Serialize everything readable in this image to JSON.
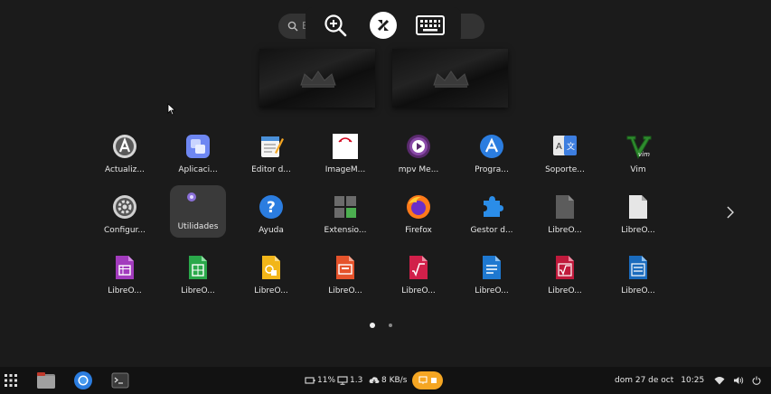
{
  "search": {
    "placeholder": "E"
  },
  "apps_row1": [
    {
      "label": "Actualiz...",
      "icon": "software-updater-icon"
    },
    {
      "label": "Aplicaci...",
      "icon": "applications-icon"
    },
    {
      "label": "Editor d...",
      "icon": "text-editor-icon"
    },
    {
      "label": "ImageM...",
      "icon": "imagemagick-icon"
    },
    {
      "label": "mpv Me...",
      "icon": "mpv-media-player-icon"
    },
    {
      "label": "Progra...",
      "icon": "software-icon"
    },
    {
      "label": "Soporte...",
      "icon": "language-support-icon"
    },
    {
      "label": "Vim",
      "icon": "vim-icon"
    }
  ],
  "apps_row2": [
    {
      "label": "Configur...",
      "icon": "settings-icon"
    },
    {
      "label": "Utilidades",
      "icon": "utilities-folder-icon"
    },
    {
      "label": "Ayuda",
      "icon": "help-icon"
    },
    {
      "label": "Extensio...",
      "icon": "extensions-icon"
    },
    {
      "label": "Firefox",
      "icon": "firefox-icon"
    },
    {
      "label": "Gestor d...",
      "icon": "extension-manager-icon"
    },
    {
      "label": "LibreO...",
      "icon": "libreoffice-icon"
    },
    {
      "label": "LibreO...",
      "icon": "libreoffice-document-icon"
    }
  ],
  "apps_row3": [
    {
      "label": "LibreO...",
      "icon": "libreoffice-base-icon"
    },
    {
      "label": "LibreO...",
      "icon": "libreoffice-calc-icon"
    },
    {
      "label": "LibreO...",
      "icon": "libreoffice-draw-icon"
    },
    {
      "label": "LibreO...",
      "icon": "libreoffice-impress-icon"
    },
    {
      "label": "LibreO...",
      "icon": "libreoffice-math-icon"
    },
    {
      "label": "LibreO...",
      "icon": "libreoffice-writer-icon"
    },
    {
      "label": "LibreO...",
      "icon": "libreoffice-math-icon"
    },
    {
      "label": "LibreO...",
      "icon": "libreoffice-writer-icon"
    }
  ],
  "panel": {
    "battery": "11%",
    "load": "1.3",
    "net": "8 KB/s",
    "date": "dom 27 de oct",
    "time": "10:25"
  },
  "colors": {
    "background": "#1b1b1b",
    "panel": "#121212",
    "accent_orange": "#f5a623",
    "folder_bg": "#3a3a3a"
  }
}
